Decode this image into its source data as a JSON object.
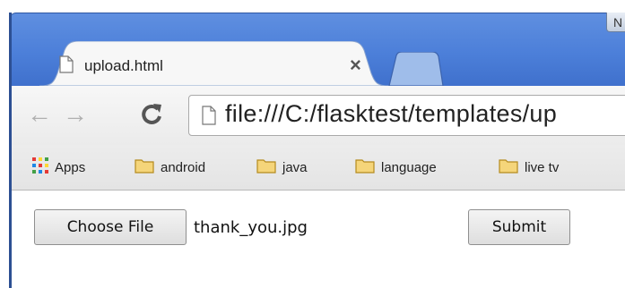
{
  "window": {
    "min_button_label": "N"
  },
  "tab": {
    "title": "upload.html",
    "close_glyph": "×"
  },
  "toolbar": {
    "back_glyph": "←",
    "forward_glyph": "→",
    "url": "file:///C:/flasktest/templates/up"
  },
  "bookmarks": {
    "items": [
      {
        "label": "Apps",
        "icon": "apps-grid-icon"
      },
      {
        "label": "android",
        "icon": "folder-icon"
      },
      {
        "label": "java",
        "icon": "folder-icon"
      },
      {
        "label": "language",
        "icon": "folder-icon"
      },
      {
        "label": "live tv",
        "icon": "folder-icon"
      }
    ]
  },
  "form": {
    "choose_label": "Choose File",
    "filename": "thank_you.jpg",
    "submit_label": "Submit"
  },
  "colors": {
    "titlebar": "#4c7fd9",
    "folder": "#f5d57a"
  }
}
